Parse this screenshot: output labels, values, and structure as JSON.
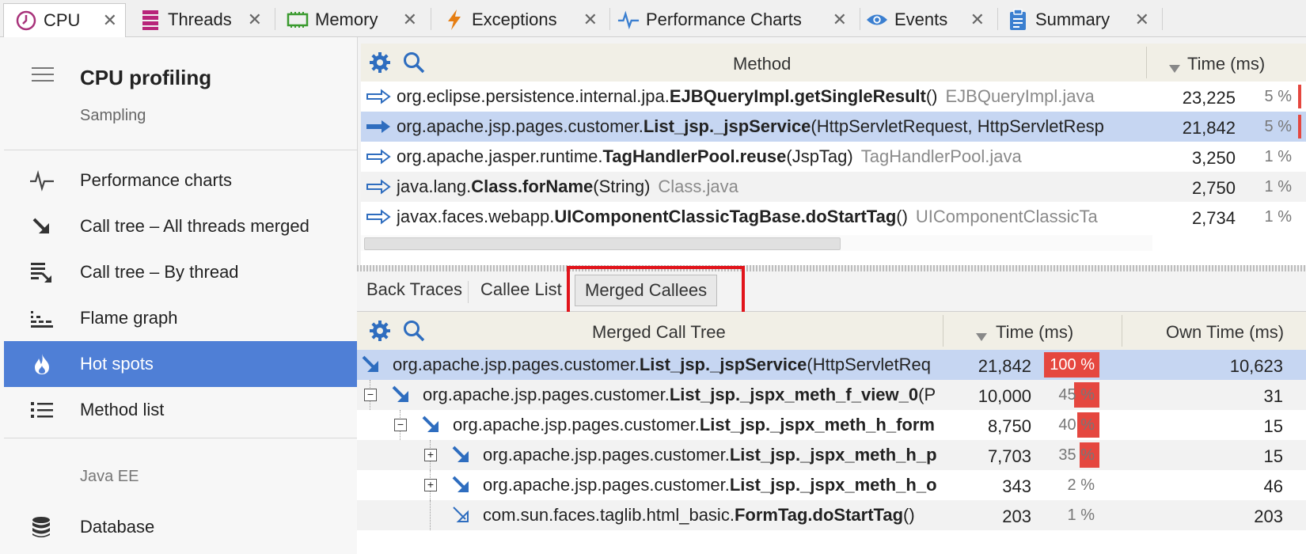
{
  "tabs": [
    {
      "label": "CPU",
      "icon": "clock-icon",
      "color": "#a8327a"
    },
    {
      "label": "Threads",
      "icon": "threads-icon",
      "color": "#b8247a"
    },
    {
      "label": "Memory",
      "icon": "memory-chip-icon",
      "color": "#3a9a2e"
    },
    {
      "label": "Exceptions",
      "icon": "lightning-icon",
      "color": "#e67e12"
    },
    {
      "label": "Performance Charts",
      "icon": "pulse-icon",
      "color": "#3b7fd0"
    },
    {
      "label": "Events",
      "icon": "eye-icon",
      "color": "#3b7fd0"
    },
    {
      "label": "Summary",
      "icon": "clipboard-icon",
      "color": "#3b7fd0"
    }
  ],
  "sidebar": {
    "title": "CPU profiling",
    "subtitle": "Sampling",
    "items": [
      {
        "label": "Performance charts",
        "icon": "pulse-icon"
      },
      {
        "label": "Call tree – All threads merged",
        "icon": "arrow-down-right-icon"
      },
      {
        "label": "Call tree – By thread",
        "icon": "stacked-tree-icon"
      },
      {
        "label": "Flame graph",
        "icon": "flame-graph-icon"
      },
      {
        "label": "Hot spots",
        "icon": "fire-icon"
      },
      {
        "label": "Method list",
        "icon": "list-icon"
      }
    ],
    "section": "Java EE",
    "section_items": [
      {
        "label": "Database",
        "icon": "database-icon"
      }
    ]
  },
  "hotspots": {
    "col_method": "Method",
    "col_time": "Time (ms)",
    "rows": [
      {
        "pre": "org.eclipse.persistence.internal.jpa.",
        "bold": "EJBQueryImpl.getSingleResult",
        "post": "()",
        "file": "EJBQueryImpl.java",
        "time": "23,225",
        "pct": "5 %",
        "selected": false
      },
      {
        "pre": "org.apache.jsp.pages.customer.",
        "bold": "List_jsp._jspService",
        "post": "(HttpServletRequest, HttpServletResp",
        "file": "",
        "time": "21,842",
        "pct": "5 %",
        "selected": true
      },
      {
        "pre": "org.apache.jasper.runtime.",
        "bold": "TagHandlerPool.reuse",
        "post": "(JspTag)",
        "file": "TagHandlerPool.java",
        "time": "3,250",
        "pct": "1 %",
        "selected": false
      },
      {
        "pre": "java.lang.",
        "bold": "Class.forName",
        "post": "(String)",
        "file": "Class.java",
        "time": "2,750",
        "pct": "1 %",
        "selected": false
      },
      {
        "pre": "javax.faces.webapp.",
        "bold": "UIComponentClassicTagBase.doStartTag",
        "post": "()",
        "file": "UIComponentClassicTa",
        "time": "2,734",
        "pct": "1 %",
        "selected": false
      }
    ]
  },
  "subtabs": [
    "Back Traces",
    "Callee List",
    "Merged Callees"
  ],
  "calltree": {
    "col_tree": "Merged Call Tree",
    "col_time": "Time (ms)",
    "col_own": "Own Time (ms)",
    "rows": [
      {
        "depth": 0,
        "expander": "",
        "pre": "org.apache.jsp.pages.customer.",
        "bold": "List_jsp._jspService",
        "post": "(HttpServletReq",
        "time": "21,842",
        "pct": "100 %",
        "frac": 1.0,
        "own": "10,623",
        "selected": true,
        "hollow": false
      },
      {
        "depth": 1,
        "expander": "⊟",
        "pre": "org.apache.jsp.pages.customer.",
        "bold": "List_jsp._jspx_meth_f_view_0",
        "post": "(P",
        "time": "10,000",
        "pct": "45 %",
        "frac": 0.45,
        "own": "31",
        "selected": false,
        "hollow": false
      },
      {
        "depth": 2,
        "expander": "⊟",
        "pre": "org.apache.jsp.pages.customer.",
        "bold": "List_jsp._jspx_meth_h_form",
        "post": "",
        "time": "8,750",
        "pct": "40 %",
        "frac": 0.4,
        "own": "15",
        "selected": false,
        "hollow": false
      },
      {
        "depth": 3,
        "expander": "⊞",
        "pre": "org.apache.jsp.pages.customer.",
        "bold": "List_jsp._jspx_meth_h_p",
        "post": "",
        "time": "7,703",
        "pct": "35 %",
        "frac": 0.35,
        "own": "15",
        "selected": false,
        "hollow": false
      },
      {
        "depth": 3,
        "expander": "⊞",
        "pre": "org.apache.jsp.pages.customer.",
        "bold": "List_jsp._jspx_meth_h_o",
        "post": "",
        "time": "343",
        "pct": "2 %",
        "frac": 0.02,
        "own": "46",
        "selected": false,
        "hollow": false
      },
      {
        "depth": 3,
        "expander": "",
        "pre": "com.sun.faces.taglib.html_basic.",
        "bold": "FormTag.doStartTag",
        "post": "()",
        "time": "203",
        "pct": "1 %",
        "frac": 0.01,
        "own": "203",
        "selected": false,
        "hollow": true
      }
    ]
  }
}
